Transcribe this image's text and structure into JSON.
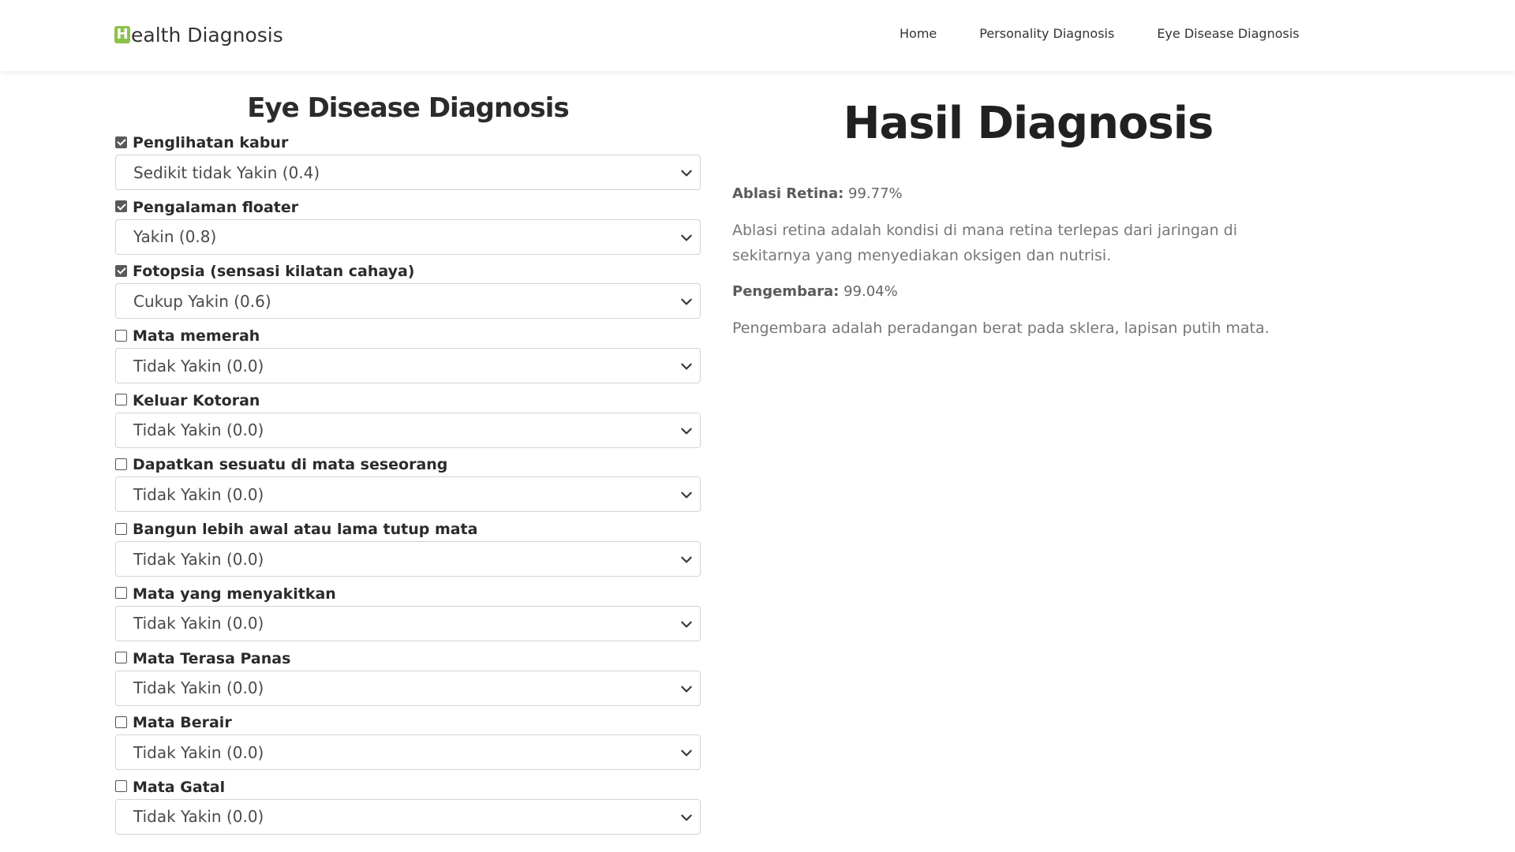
{
  "navbar": {
    "brand_initial": "H",
    "brand_rest": "ealth Diagnosis",
    "links": [
      "Home",
      "Personality Diagnosis",
      "Eye Disease Diagnosis"
    ]
  },
  "form": {
    "title": "Eye Disease Diagnosis",
    "symptoms": [
      {
        "label": "Penglihatan kabur",
        "checked": true,
        "value": "Sedikit tidak Yakin (0.4)"
      },
      {
        "label": "Pengalaman floater",
        "checked": true,
        "value": "Yakin (0.8)"
      },
      {
        "label": "Fotopsia (sensasi kilatan cahaya)",
        "checked": true,
        "value": "Cukup Yakin (0.6)"
      },
      {
        "label": "Mata memerah",
        "checked": false,
        "value": "Tidak Yakin (0.0)"
      },
      {
        "label": "Keluar Kotoran",
        "checked": false,
        "value": "Tidak Yakin (0.0)"
      },
      {
        "label": "Dapatkan sesuatu di mata seseorang",
        "checked": false,
        "value": "Tidak Yakin (0.0)"
      },
      {
        "label": "Bangun lebih awal atau lama tutup mata",
        "checked": false,
        "value": "Tidak Yakin (0.0)"
      },
      {
        "label": "Mata yang menyakitkan",
        "checked": false,
        "value": "Tidak Yakin (0.0)"
      },
      {
        "label": "Mata Terasa Panas",
        "checked": false,
        "value": "Tidak Yakin (0.0)"
      },
      {
        "label": "Mata Berair",
        "checked": false,
        "value": "Tidak Yakin (0.0)"
      },
      {
        "label": "Mata Gatal",
        "checked": false,
        "value": "Tidak Yakin (0.0)"
      }
    ]
  },
  "result": {
    "title": "Hasil Diagnosis",
    "items": [
      {
        "disease": "Ablasi Retina:",
        "percent": "99.77%",
        "description": "Ablasi retina adalah kondisi di mana retina terlepas dari jaringan di sekitarnya yang menyediakan oksigen dan nutrisi."
      },
      {
        "disease": "Pengembara:",
        "percent": "99.04%",
        "description": "Pengembara adalah peradangan berat pada sklera, lapisan putih mata."
      }
    ]
  }
}
